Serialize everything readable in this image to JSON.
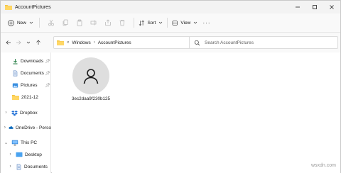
{
  "window": {
    "title": "AccountPictures"
  },
  "toolbar": {
    "new_label": "New",
    "sort_label": "Sort",
    "view_label": "View"
  },
  "address": {
    "crumbs": [
      "Windows",
      "AccountPictures"
    ]
  },
  "search": {
    "placeholder": "Search AccountPictures"
  },
  "nav": {
    "quick_access": [
      {
        "label": "Downloads",
        "pinned": true
      },
      {
        "label": "Documents",
        "pinned": true
      },
      {
        "label": "Pictures",
        "pinned": true
      },
      {
        "label": "2021-12",
        "pinned": false
      }
    ],
    "dropbox": "Dropbox",
    "onedrive": "OneDrive - Perso",
    "this_pc": "This PC",
    "desktop": "Desktop",
    "documents2": "Documents"
  },
  "files": [
    {
      "name": "3ec2daa9f230b125"
    }
  ],
  "watermark": "wsxdn.com",
  "colors": {
    "folder": "#f4c542",
    "accent": "#0067c0",
    "cloud": "#0f6cbd"
  }
}
